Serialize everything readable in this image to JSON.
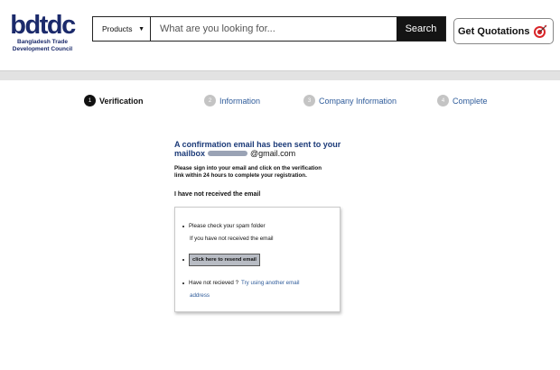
{
  "header": {
    "logo_wordmark": "bdtdc",
    "logo_line1": "Bangladesh Trade",
    "logo_line2": "Development Council",
    "search": {
      "category": "Products",
      "placeholder": "What are you looking for...",
      "button_label": "Search"
    },
    "quote_button": "Get Quotations"
  },
  "steps": [
    {
      "number": "1",
      "label": "Verification",
      "active": true
    },
    {
      "number": "2",
      "label": "Information",
      "active": false
    },
    {
      "number": "3",
      "label": "Company Information",
      "active": false
    },
    {
      "number": "4",
      "label": "Complete",
      "active": false
    }
  ],
  "confirmation": {
    "headline": "A confirmation email has been sent to your",
    "mailbox_label": "mailbox",
    "email_domain": "@gmail.com",
    "instructions_line1": "Please sign into your email and click on the verification",
    "instructions_line2": "link within 24 hours to complete your registration.",
    "not_received_heading": "I have not received the email"
  },
  "panel": {
    "spam_tip": "Please check your spam folder",
    "if_not_received": "If you have not received the email",
    "resend_button": "click here to resend email",
    "have_not_received": "Have not recieved ?",
    "try_another_line1": "Try using another email",
    "try_another_line2": "address"
  },
  "colors": {
    "accent_navy": "#1b3a78",
    "link_blue": "#2e5b9a",
    "search_button": "#141414"
  }
}
